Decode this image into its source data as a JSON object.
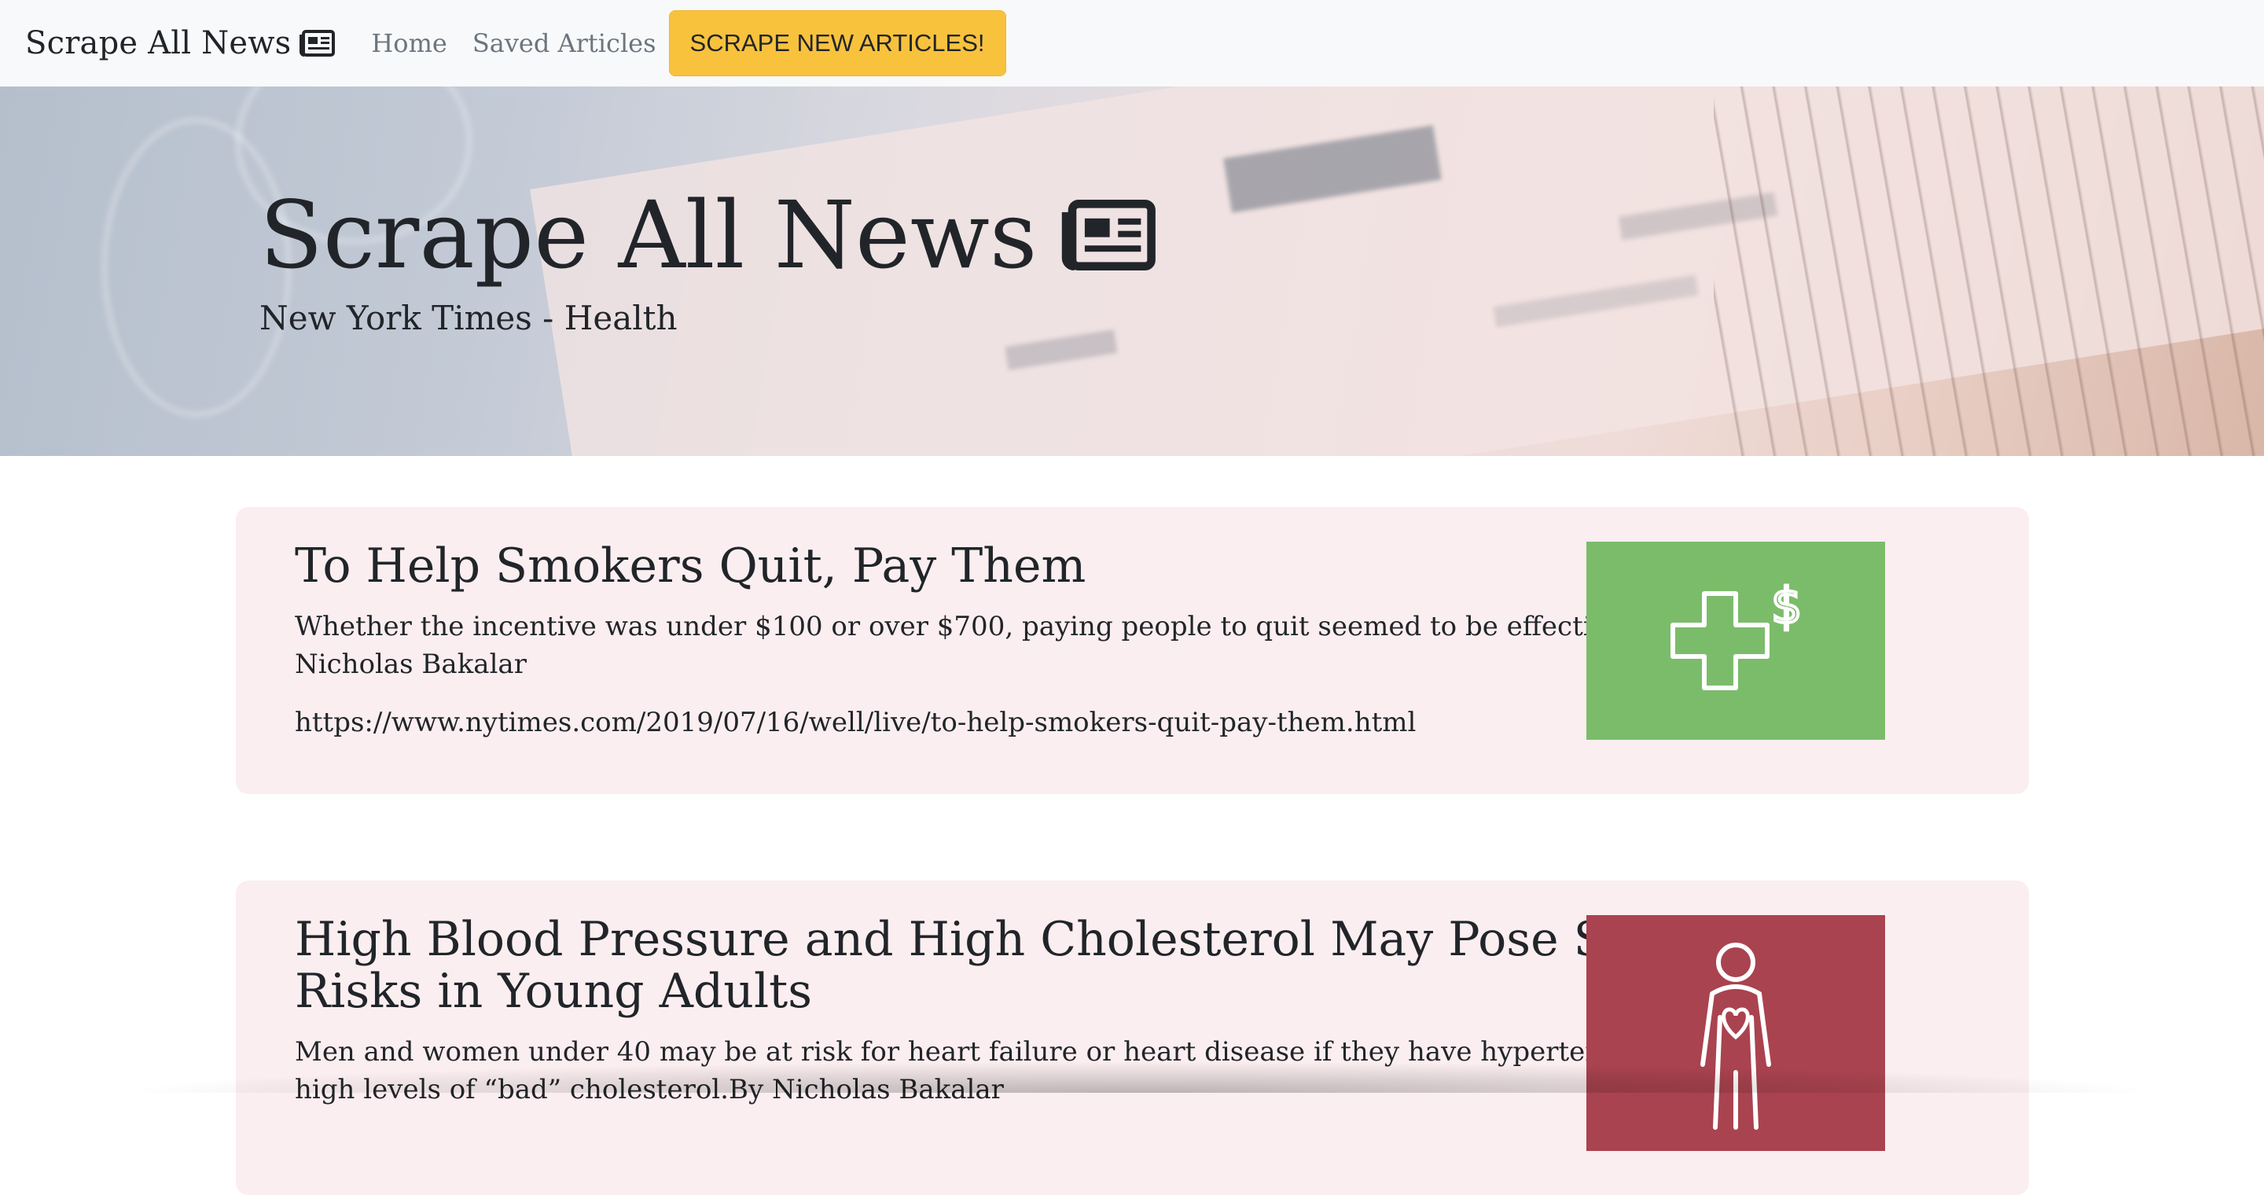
{
  "navbar": {
    "brand": "Scrape All News",
    "brand_icon": "newspaper-icon",
    "links": [
      {
        "label": "Home"
      },
      {
        "label": "Saved Articles"
      }
    ],
    "scrape_button": "SCRAPE NEW ARTICLES!"
  },
  "hero": {
    "title": "Scrape All News",
    "title_icon": "newspaper-icon",
    "subtitle": "New York Times - Health"
  },
  "articles": [
    {
      "title": "To Help Smokers Quit, Pay Them",
      "summary": "Whether the incentive was under $100 or over $700, paying people to quit seemed to be effective.By Nicholas Bakalar",
      "link": "https://www.nytimes.com/2019/07/16/well/live/to-help-smokers-quit-pay-them.html",
      "thumb_icon": "health-cross-dollar-icon",
      "thumb_color": "#7bbc6a"
    },
    {
      "title": "High Blood Pressure and High Cholesterol May Pose Special Risks in Young Adults",
      "summary": "Men and women under 40 may be at risk for heart failure or heart disease if they have hypertension or high levels of “bad” cholesterol.By Nicholas Bakalar",
      "thumb_icon": "person-heart-icon",
      "thumb_color": "#a9434f"
    }
  ],
  "colors": {
    "navbar_bg": "#f8f9fa",
    "button_bg": "#f8c23d",
    "card_bg": "#fbeef0"
  }
}
